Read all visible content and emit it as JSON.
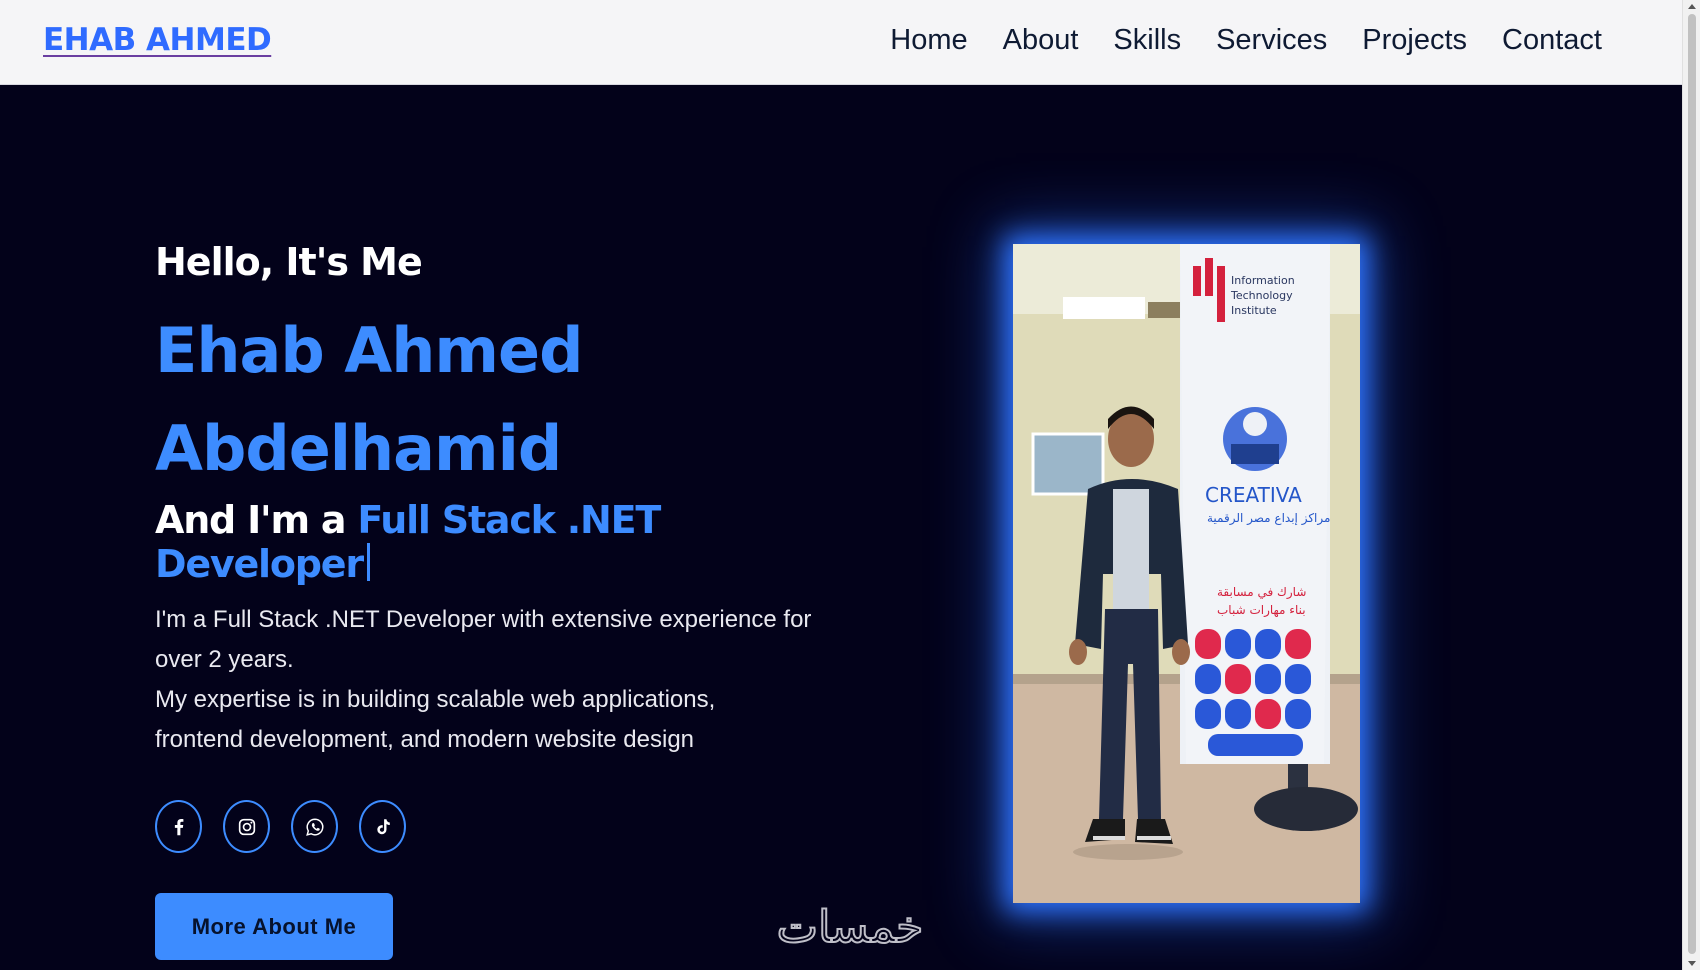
{
  "header": {
    "logo": "EHAB AHMED",
    "nav": [
      "Home",
      "About",
      "Skills",
      "Services",
      "Projects",
      "Contact"
    ]
  },
  "hero": {
    "greeting": "Hello, It's Me",
    "name_line1": "Ehab Ahmed",
    "name_line2": "Abdelhamid",
    "role_prefix": "And I'm a",
    "role": "Full Stack .NET Developer",
    "description_line1": "I'm a Full Stack .NET Developer with extensive experience for",
    "description_line2": "over 2 years.",
    "description_line3": "My expertise is in building scalable web applications,",
    "description_line4": "frontend development, and modern website design",
    "socials": [
      "facebook-icon",
      "instagram-icon",
      "whatsapp-icon",
      "tiktok-icon"
    ],
    "cta_label": "More About Me"
  },
  "photo": {
    "banner_text_1": "Information",
    "banner_text_2": "Technology",
    "banner_text_3": "Institute",
    "banner_brand": "CREATIVA",
    "banner_arabic_1": "مراكز إبداع مصر الرقمية",
    "banner_arabic_2": "شارك في مسابقة",
    "banner_arabic_3": "بناء مهارات شباب"
  },
  "watermark": "خمسات",
  "colors": {
    "accent": "#3d8cff",
    "background": "#03021a",
    "nav_bg": "#f5f5f7"
  }
}
